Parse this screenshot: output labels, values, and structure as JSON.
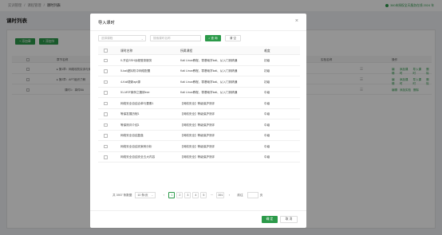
{
  "background": {
    "breadcrumb": [
      "实训管理",
      "课程管理",
      "课时列表"
    ],
    "breadcrumb_sep": "/",
    "header_right": "360未授权全天服务在线 2024 年",
    "page_title": "课时列表",
    "buttons": [
      "+ 添加章",
      "+ 添加节"
    ],
    "columns": [
      "章节名称",
      "实验名称",
      "操作"
    ],
    "rows": [
      {
        "title": "▸ 第1章：网络攻防实训与安全防护",
        "ops": [
          "编辑",
          "添加课时",
          "导入课时",
          "删除"
        ]
      },
      {
        "title": "▸ 第2章：APT组织了解",
        "ops": [
          "编辑",
          "添加课时",
          "导入课时",
          "删除"
        ]
      },
      {
        "title": "课时1：事件BA",
        "ops": [
          "编辑",
          "添加实验",
          "删除"
        ]
      }
    ]
  },
  "modal": {
    "title": "导入课时",
    "close_icon": "close-icon",
    "filters": {
      "category_placeholder": "选择课程",
      "name_placeholder": "搜索课时名称",
      "query_label": "查 询",
      "clear_label": "清 空"
    },
    "columns": {
      "name": "课时名称",
      "category": "所属课程",
      "difficulty": "难度"
    },
    "rows": [
      {
        "name": "0-开启SSH远程登录服务",
        "category": "Kali Linux教程、零基础学kali、从入门到精通",
        "difficulty": "初级"
      },
      {
        "name": "5-kali虚拟机中网络配置",
        "category": "Kali Linux教程、零基础学kali、从入门到精通",
        "difficulty": "初级"
      },
      {
        "name": "4-Kali更新apt源",
        "category": "Kali Linux教程、零基础学kali、从入门到精通",
        "difficulty": "初级"
      },
      {
        "name": "51-MSF案例之捆绑exe",
        "category": "Kali Linux教程、零基础学kali、从入门到精通",
        "difficulty": "中级"
      },
      {
        "name": "网络安全自结合单与要素1",
        "category": "【网络安全】等级保护测评",
        "difficulty": "中级"
      },
      {
        "name": "等保发展历程1",
        "category": "【网络安全】等级保护测评",
        "difficulty": "中级"
      },
      {
        "name": "等保测评介绍1",
        "category": "【网络安全】等级保护测评",
        "difficulty": "中级"
      },
      {
        "name": "网络安全自结复盘",
        "category": "【网络安全】等级保护测评",
        "difficulty": "中级"
      },
      {
        "name": "网络安全自结安案例分析",
        "category": "【网络安全】等级保护测评",
        "difficulty": "中级"
      },
      {
        "name": "网络安全自结安全五大内容",
        "category": "【网络安全】等级保护测评",
        "difficulty": "中级"
      }
    ],
    "pagination": {
      "total": "共 3907 条数据",
      "page_size": "10 条/页",
      "pages": [
        "1",
        "2",
        "3",
        "4",
        "5",
        "···",
        "391"
      ],
      "current": "1",
      "prev": "‹",
      "next": "›",
      "goto_label": "前往",
      "goto_suffix": "页"
    },
    "ok_label": "确 定",
    "cancel_label": "取 消"
  },
  "colors": {
    "accent": "#2c9a4a"
  }
}
